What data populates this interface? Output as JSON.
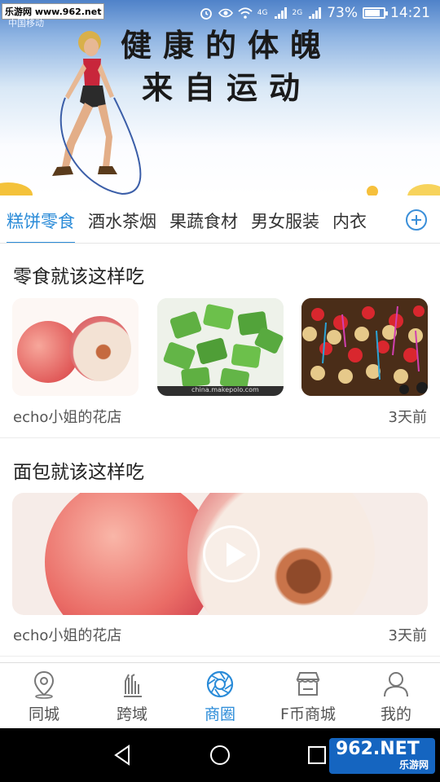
{
  "status_bar": {
    "watermark": "乐游网 www.962.net",
    "carrier": "中国移动",
    "network1": "4G",
    "network2": "2G",
    "battery": "73%",
    "battery_level": 0.73,
    "time": "14:21"
  },
  "banner": {
    "line1": "健康的体魄",
    "line2": "来自运动"
  },
  "categories": {
    "tabs": [
      "糕饼零食",
      "酒水茶烟",
      "果蔬食材",
      "男女服装",
      "内衣"
    ],
    "active_index": 0,
    "add_icon": "plus-circle-icon"
  },
  "sections": [
    {
      "title": "零食就该这样吃",
      "shop": "echo小姐的花店",
      "time": "3天前",
      "images": [
        "peach",
        "green-snack-packets",
        "party-food"
      ],
      "image_caption": "china.makepolo.com"
    },
    {
      "title": "面包就该这样吃",
      "shop": "echo小姐的花店",
      "time": "3天前",
      "video_icon": "play-icon"
    }
  ],
  "bottom_nav": {
    "items": [
      {
        "label": "同城",
        "icon": "location-pin-icon"
      },
      {
        "label": "跨域",
        "icon": "hand-icon"
      },
      {
        "label": "商圈",
        "icon": "camera-aperture-icon"
      },
      {
        "label": "F币商城",
        "icon": "store-icon"
      },
      {
        "label": "我的",
        "icon": "person-icon"
      }
    ],
    "active_index": 2,
    "active_color": "#2a8bd8"
  },
  "system_nav": {
    "watermark_main": "962.NET",
    "watermark_sub": "乐游网"
  }
}
